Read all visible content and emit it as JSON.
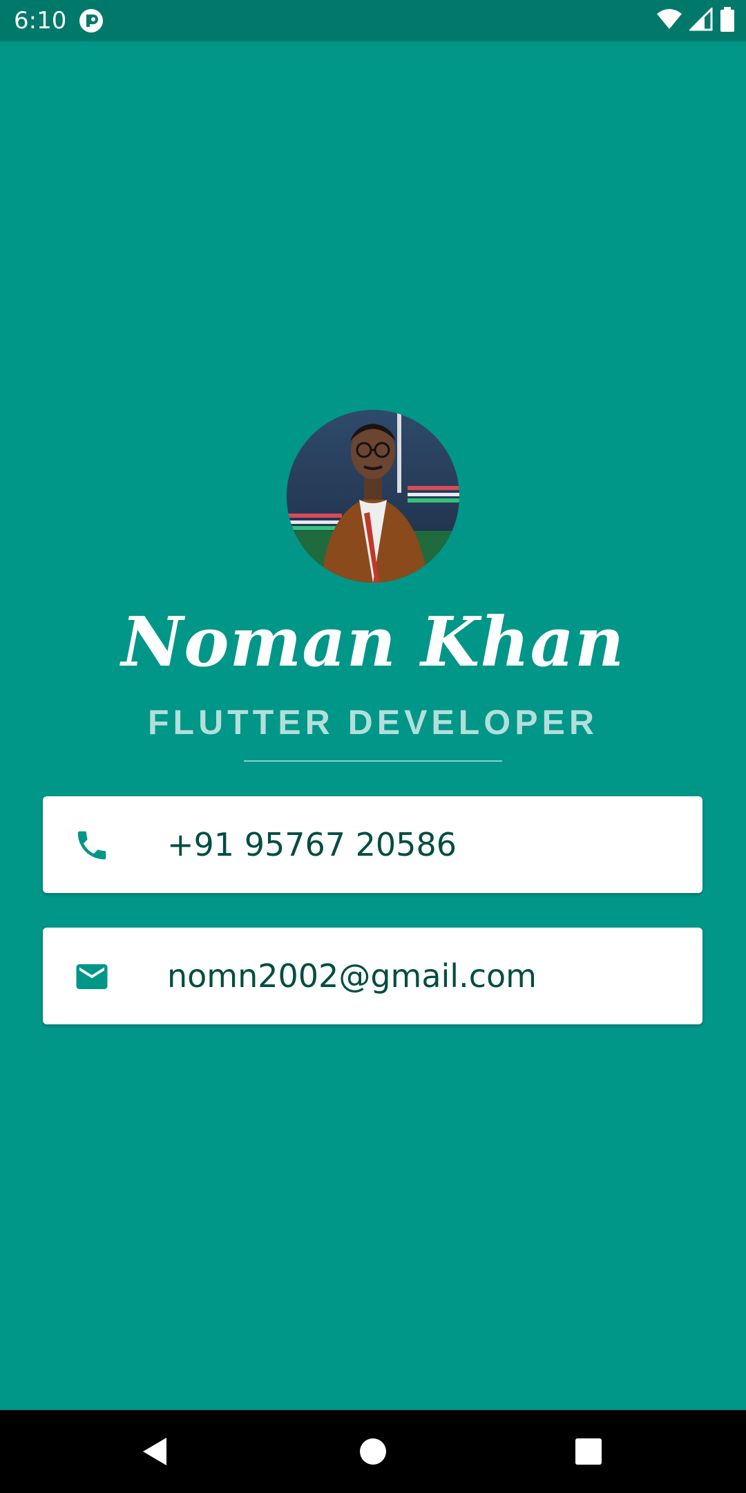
{
  "status_bar": {
    "time": "6:10",
    "icons": [
      "app-notification-icon",
      "wifi-icon",
      "cell-signal-icon",
      "battery-icon"
    ]
  },
  "profile": {
    "avatar": "profile-photo",
    "name": "Noman Khan",
    "role": "FLUTTER DEVELOPER"
  },
  "contacts": {
    "phone": {
      "icon": "phone-icon",
      "value": "+91 95767 20586"
    },
    "email": {
      "icon": "mail-icon",
      "value": "nomn2002@gmail.com"
    }
  },
  "nav_bar": {
    "buttons": [
      "back-icon",
      "home-icon",
      "recents-icon"
    ]
  },
  "colors": {
    "background": "#009688",
    "status_bar": "#00796B",
    "role_text": "#B2DFDB",
    "card_text": "#004D40",
    "card_icon": "#009688"
  }
}
